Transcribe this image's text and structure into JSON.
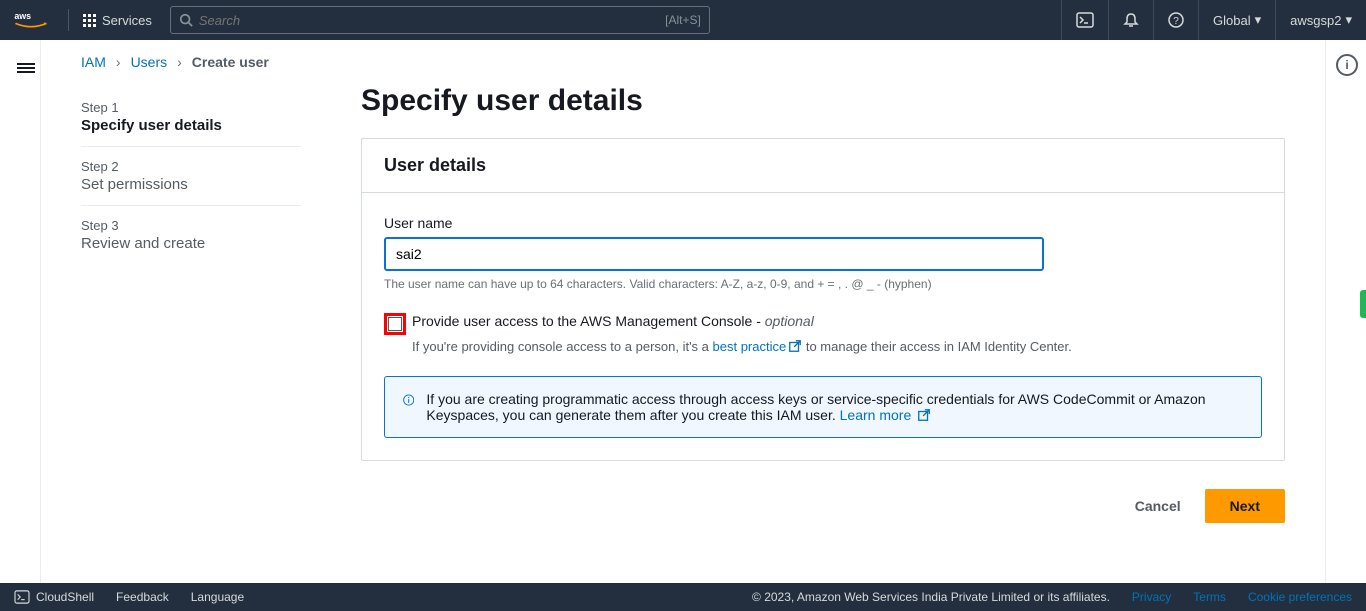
{
  "topnav": {
    "services_label": "Services",
    "search_placeholder": "Search",
    "search_kbd": "[Alt+S]",
    "region": "Global",
    "account": "awsgsp2"
  },
  "breadcrumbs": {
    "root": "IAM",
    "mid": "Users",
    "current": "Create user"
  },
  "steps": [
    {
      "num": "Step 1",
      "title": "Specify user details"
    },
    {
      "num": "Step 2",
      "title": "Set permissions"
    },
    {
      "num": "Step 3",
      "title": "Review and create"
    }
  ],
  "page_title": "Specify user details",
  "panel": {
    "header": "User details",
    "username_label": "User name",
    "username_value": "sai2",
    "username_hint": "The user name can have up to 64 characters. Valid characters: A-Z, a-z, 0-9, and + = , . @ _ - (hyphen)",
    "checkbox_label_main": "Provide user access to the AWS Management Console - ",
    "checkbox_label_optional": "optional",
    "checkbox_sub_pre": "If you're providing console access to a person, it's a ",
    "checkbox_sub_link": "best practice",
    "checkbox_sub_post": " to manage their access in IAM Identity Center.",
    "info_text": "If you are creating programmatic access through access keys or service-specific credentials for AWS CodeCommit or Amazon Keyspaces, you can generate them after you create this IAM user. ",
    "info_link": "Learn more"
  },
  "actions": {
    "cancel": "Cancel",
    "next": "Next"
  },
  "footer": {
    "cloudshell": "CloudShell",
    "feedback": "Feedback",
    "language": "Language",
    "copyright": "© 2023, Amazon Web Services India Private Limited or its affiliates.",
    "privacy": "Privacy",
    "terms": "Terms",
    "cookie": "Cookie preferences"
  }
}
